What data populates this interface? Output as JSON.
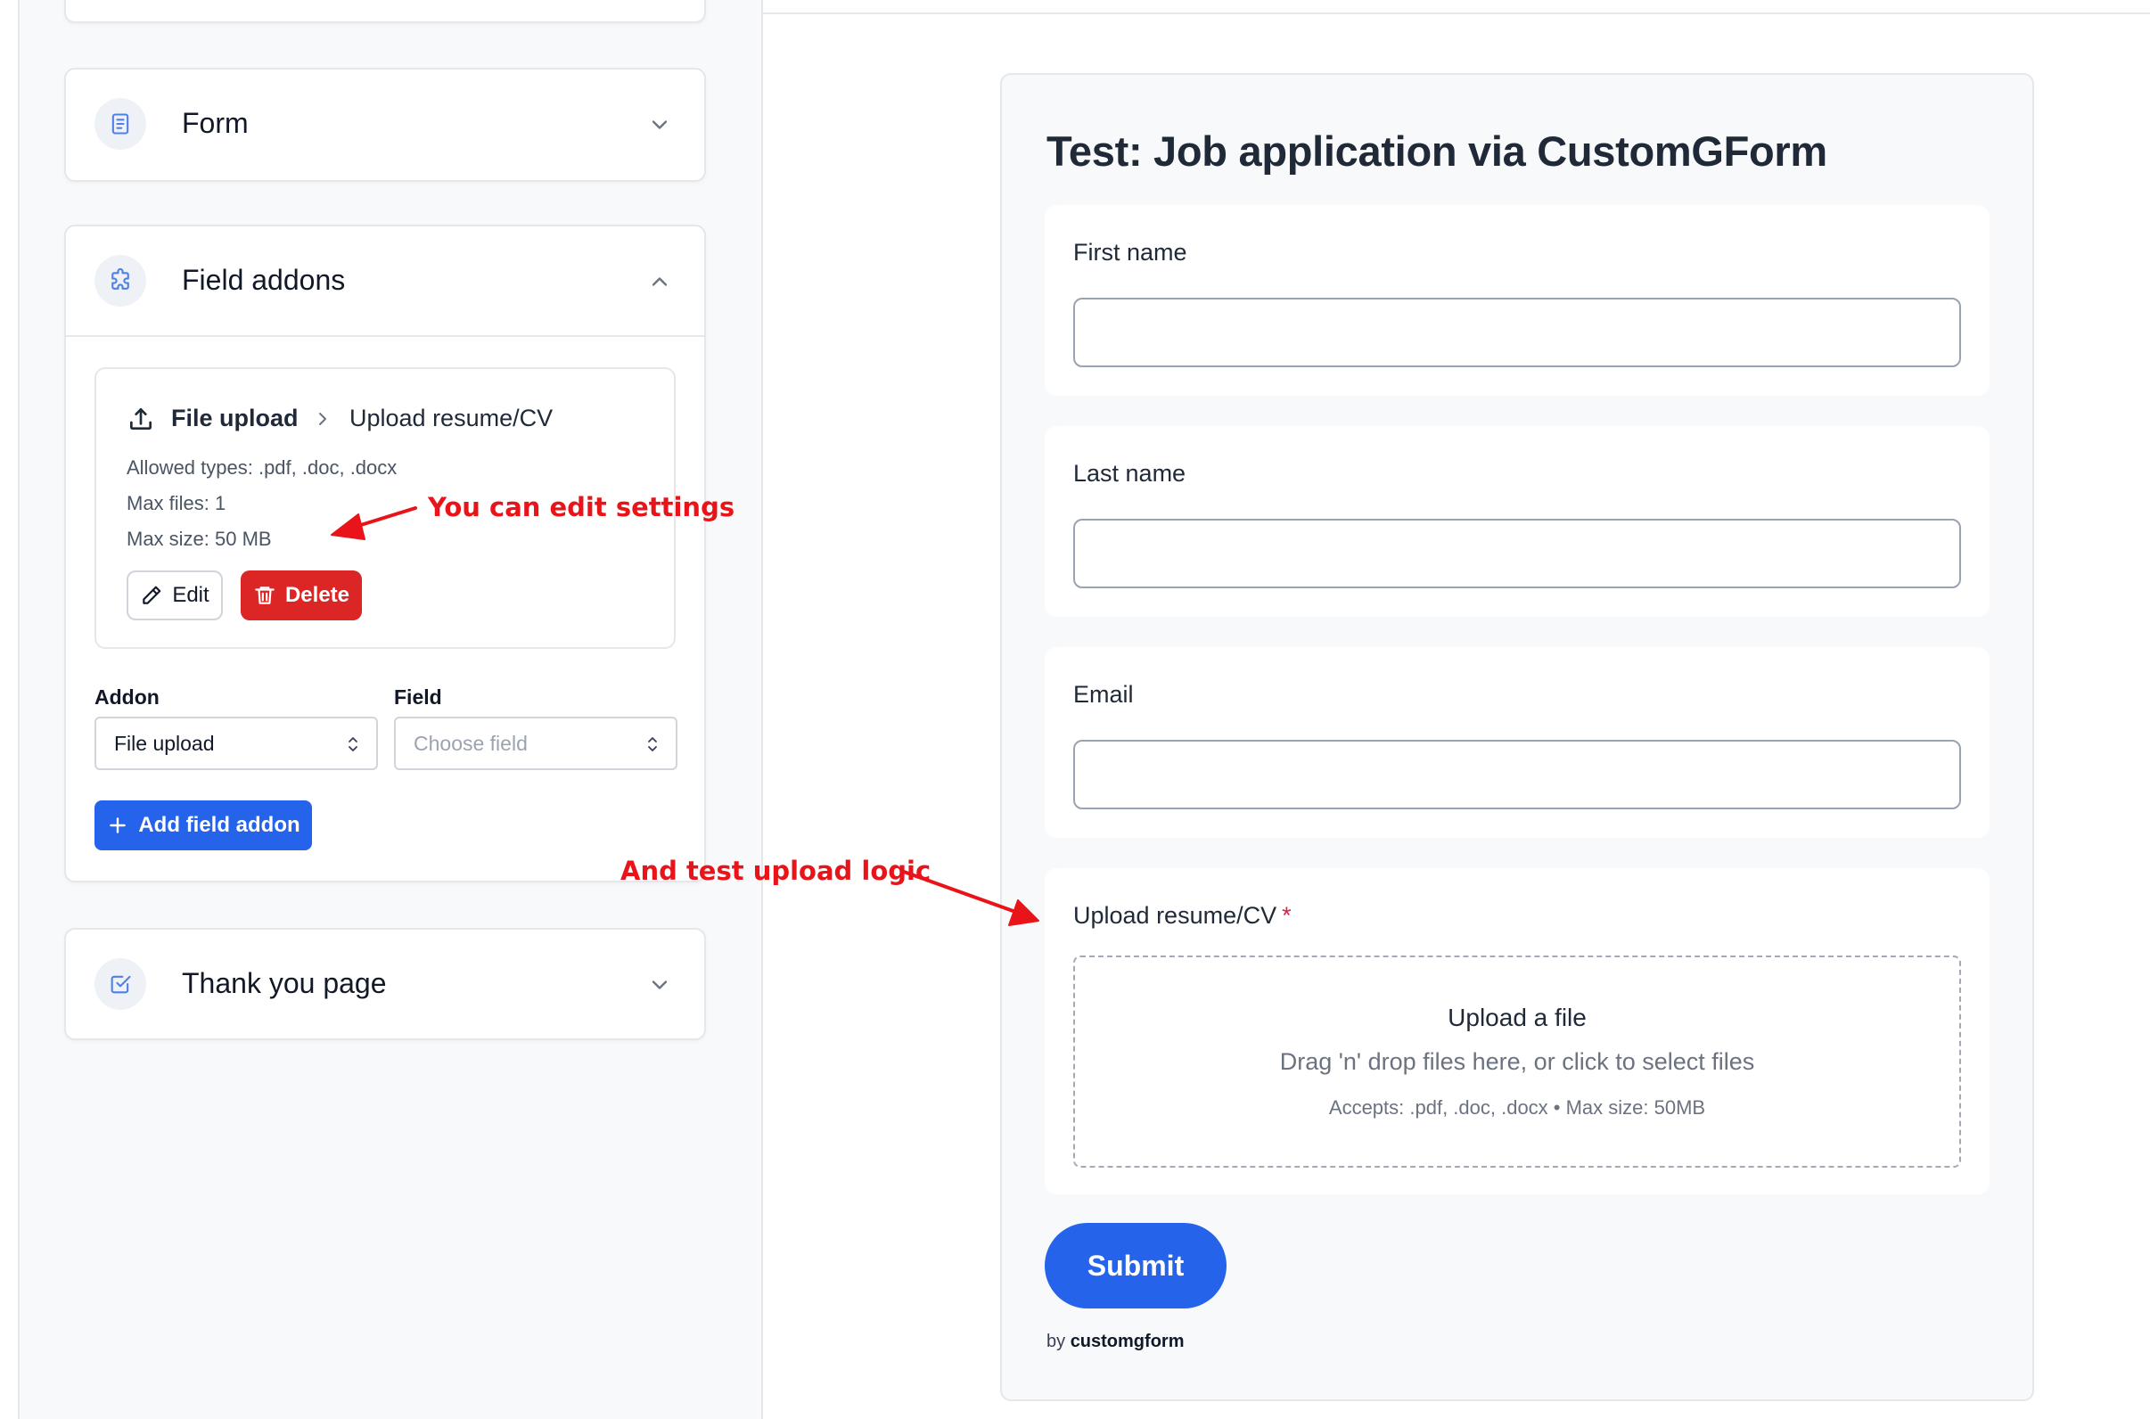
{
  "sidebar": {
    "sections": {
      "form": {
        "title": "Form",
        "icon": "document-icon",
        "state": "collapsed"
      },
      "field_addons": {
        "title": "Field addons",
        "icon": "puzzle-icon",
        "state": "expanded"
      },
      "thank_you": {
        "title": "Thank you page",
        "icon": "check-square-icon",
        "state": "collapsed"
      }
    },
    "addon_item": {
      "type": "File upload",
      "field": "Upload resume/CV",
      "allowed_types": "Allowed types: .pdf, .doc, .docx",
      "max_files": "Max files: 1",
      "max_size": "Max size: 50 MB",
      "edit_label": "Edit",
      "delete_label": "Delete"
    },
    "addon_select": {
      "label": "Addon",
      "value": "File upload"
    },
    "field_select": {
      "label": "Field",
      "placeholder": "Choose field"
    },
    "add_button": "Add field addon"
  },
  "annotations": {
    "edit_settings": "You can edit settings",
    "test_upload": "And test upload logic"
  },
  "form": {
    "title": "Test: Job application via CustomGForm",
    "fields": [
      {
        "label": "First name",
        "value": ""
      },
      {
        "label": "Last name",
        "value": ""
      },
      {
        "label": "Email",
        "value": ""
      }
    ],
    "upload": {
      "label": "Upload resume/CV",
      "required_mark": "*",
      "title": "Upload a file",
      "subtitle": "Drag 'n' drop files here, or click to select files",
      "meta": "Accepts: .pdf, .doc, .docx • Max size: 50MB"
    },
    "submit_label": "Submit",
    "by_prefix": "by",
    "by_brand": "customgform"
  },
  "colors": {
    "primary": "#2563eb",
    "danger": "#dc2626",
    "annotation": "#e8141a",
    "panel_bg": "#f8f9fb"
  }
}
